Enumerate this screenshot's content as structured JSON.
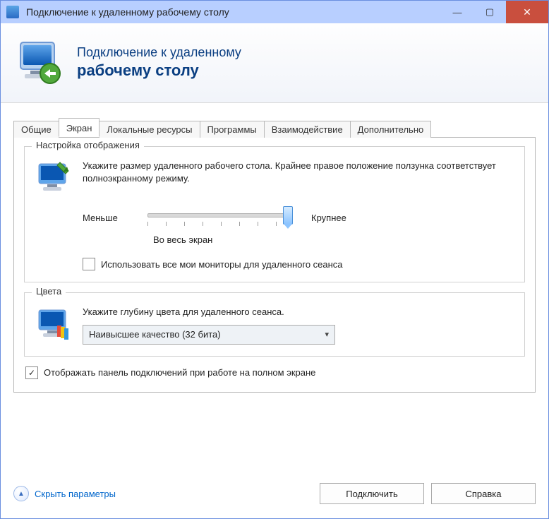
{
  "window": {
    "title": "Подключение к удаленному рабочему столу"
  },
  "banner": {
    "line1": "Подключение к удаленному",
    "line2": "рабочему столу"
  },
  "tabs": [
    {
      "label": "Общие"
    },
    {
      "label": "Экран"
    },
    {
      "label": "Локальные ресурсы"
    },
    {
      "label": "Программы"
    },
    {
      "label": "Взаимодействие"
    },
    {
      "label": "Дополнительно"
    }
  ],
  "display_group": {
    "legend": "Настройка отображения",
    "desc": "Укажите размер удаленного рабочего стола. Крайнее правое положение ползунка соответствует полноэкранному режиму.",
    "slider_min": "Меньше",
    "slider_max": "Крупнее",
    "slider_value_label": "Во весь экран",
    "use_all_monitors": "Использовать все мои мониторы для удаленного сеанса",
    "use_all_monitors_checked": false
  },
  "colors_group": {
    "legend": "Цвета",
    "desc": "Укажите глубину цвета для удаленного сеанса.",
    "selected": "Наивысшее качество (32 бита)"
  },
  "show_bar": {
    "label": "Отображать панель подключений при работе на полном экране",
    "checked": true
  },
  "footer": {
    "collapse": "Скрыть параметры",
    "connect": "Подключить",
    "help": "Справка"
  }
}
